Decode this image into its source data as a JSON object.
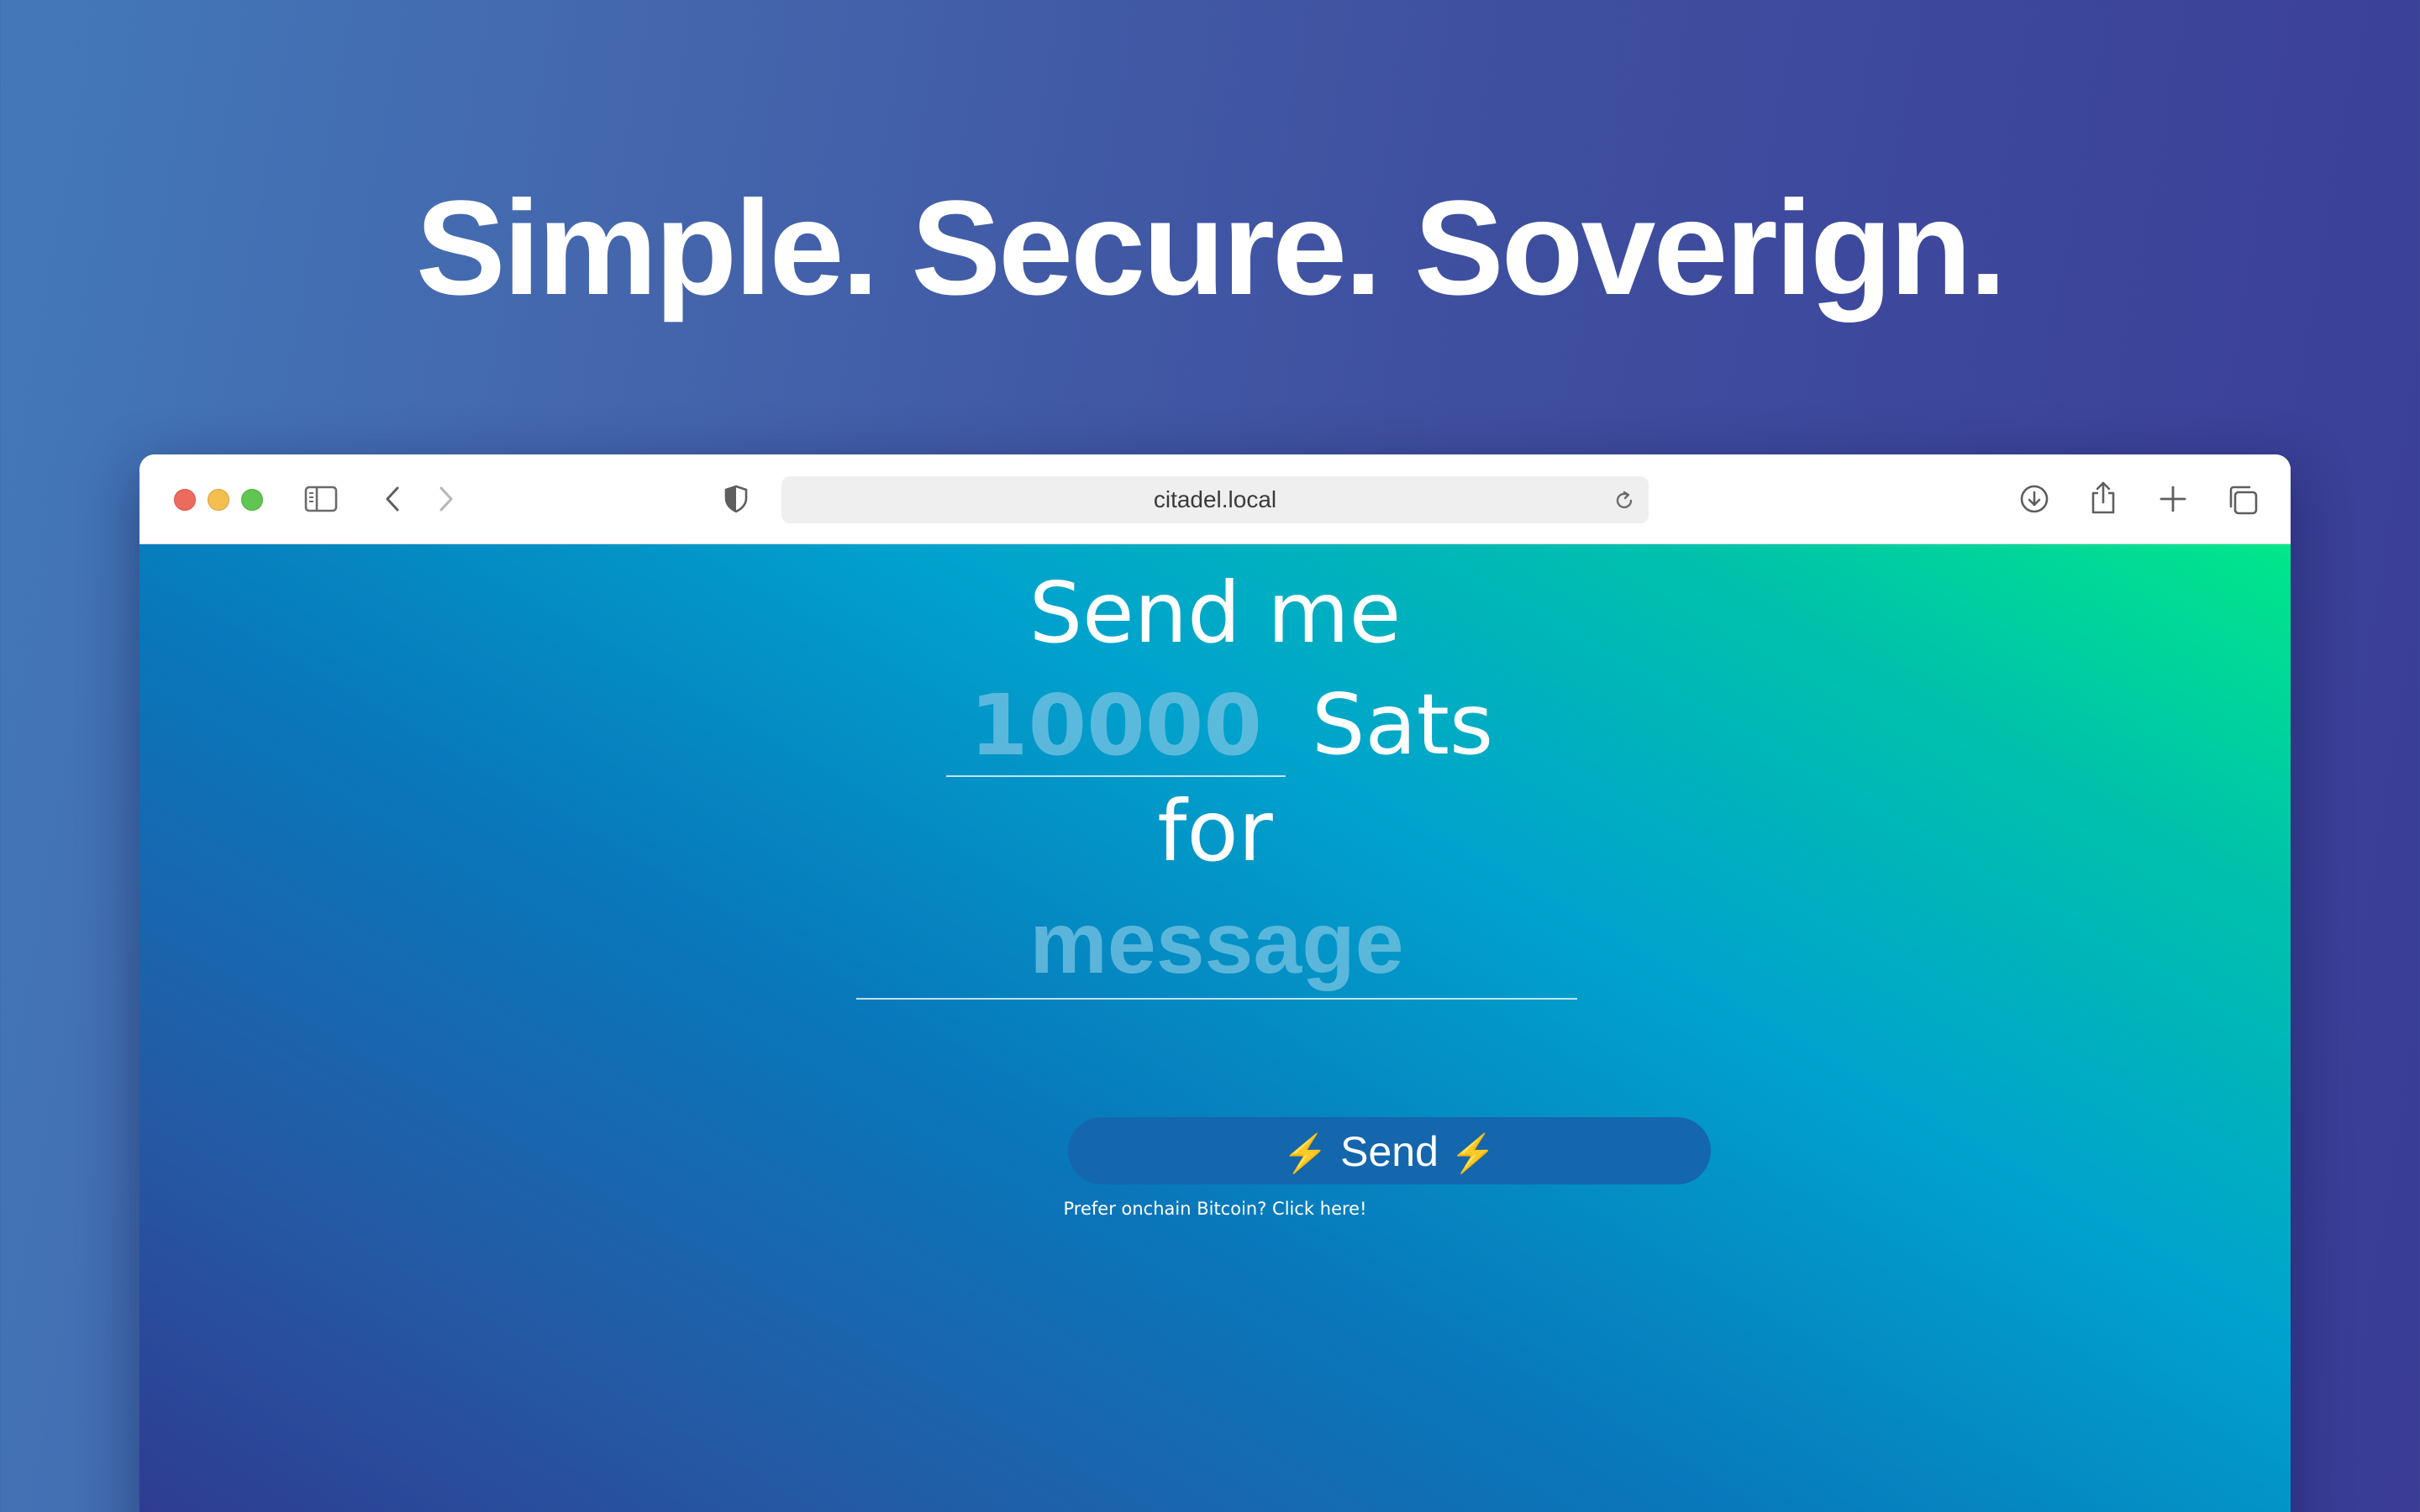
{
  "headline": "Simple. Secure. Soverign.",
  "browser": {
    "url": "citadel.local"
  },
  "form": {
    "send_me_label": "Send me",
    "amount_placeholder": "10000",
    "unit_label": "Sats",
    "for_label": "for",
    "message_placeholder": "message",
    "send_button_label": "Send",
    "bolt_emoji": "⚡",
    "onchain_link": "Prefer onchain Bitcoin? Click here!"
  },
  "icons": {
    "toolbar": [
      "sidebar-icon",
      "back-icon",
      "forward-icon",
      "privacy-shield-icon",
      "reload-icon",
      "downloads-icon",
      "share-icon",
      "new-tab-icon",
      "tabs-overview-icon"
    ]
  },
  "colors": {
    "send_button": "#1466ad",
    "bolt": "#f6c324"
  }
}
